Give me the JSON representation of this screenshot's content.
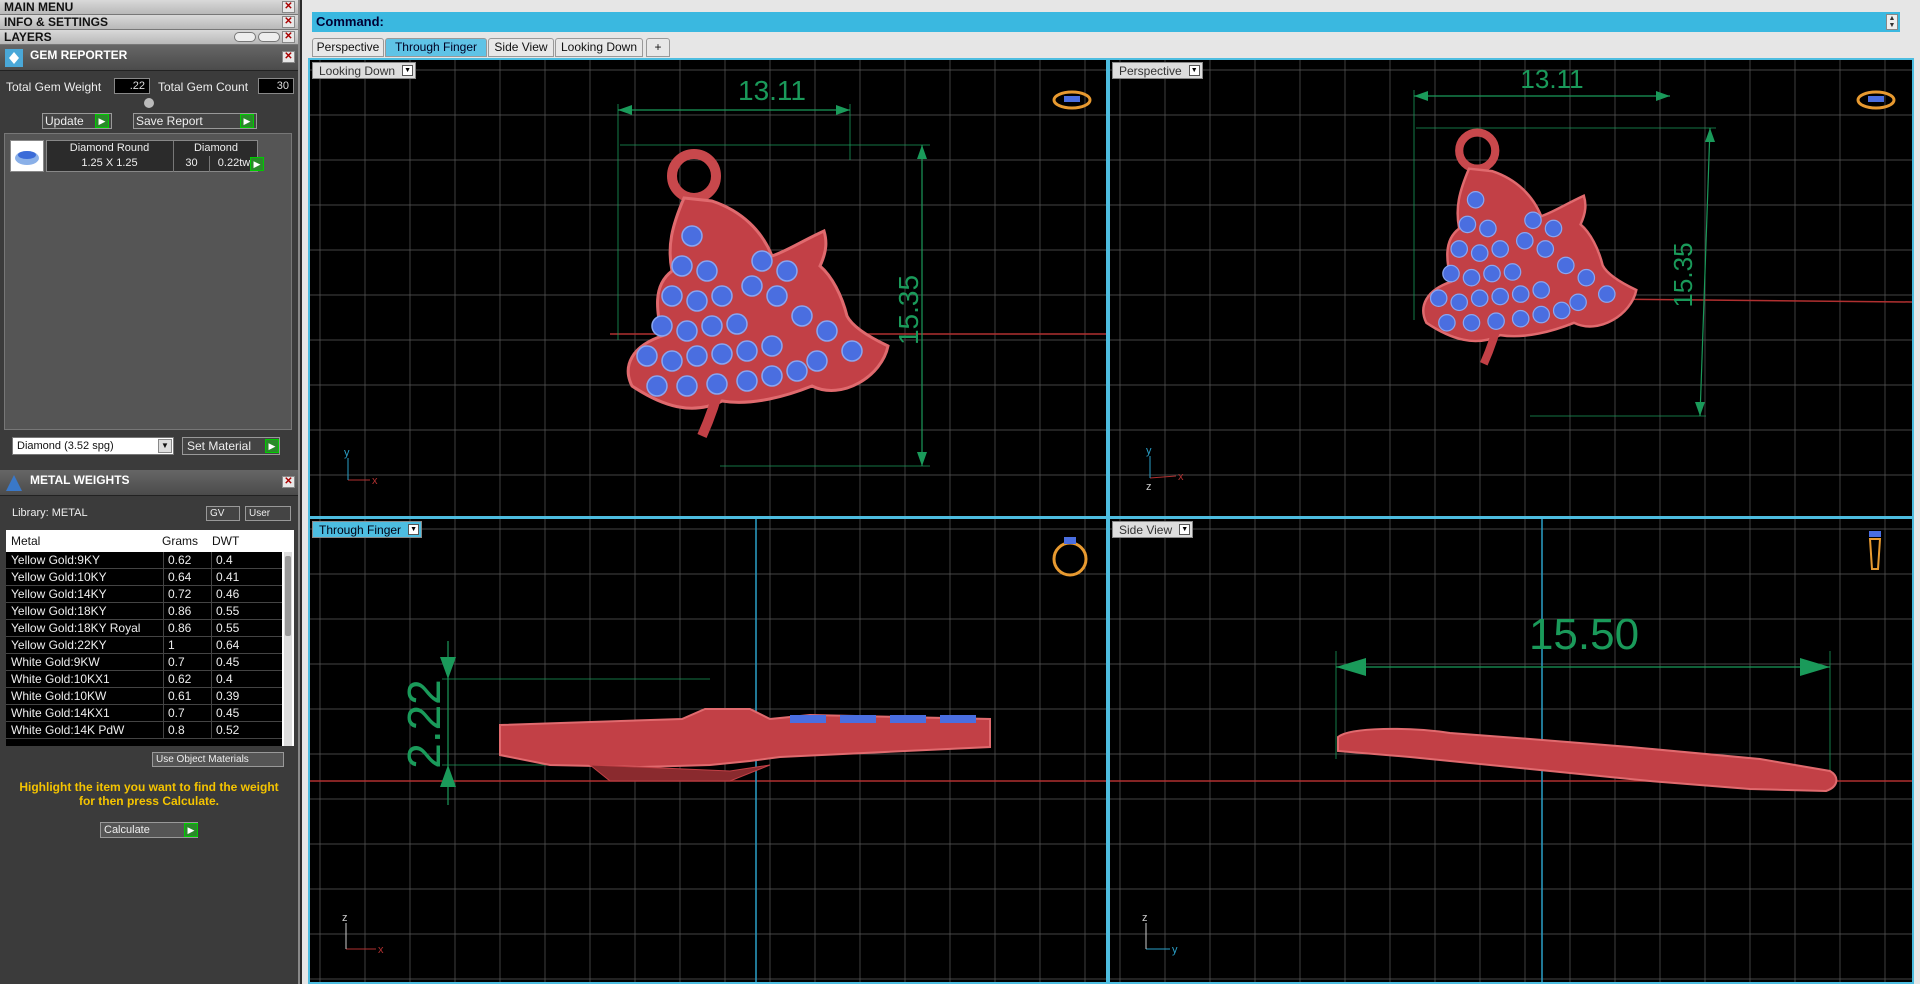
{
  "menu": {
    "main_menu": "MAIN MENU",
    "info_settings": "INFO & SETTINGS",
    "layers": "LAYERS"
  },
  "gem_reporter": {
    "title": "GEM REPORTER",
    "total_weight_label": "Total Gem Weight",
    "total_weight_value": ".22",
    "total_count_label": "Total Gem Count",
    "total_count_value": "30",
    "update_label": "Update",
    "save_report_label": "Save Report",
    "gem": {
      "name": "Diamond Round",
      "type": "Diamond",
      "size": "1.25 X 1.25",
      "count": "30",
      "weight": "0.22tw"
    },
    "material_select": "Diamond    (3.52 spg)",
    "set_material_label": "Set Material"
  },
  "metal_weights": {
    "title": "METAL WEIGHTS",
    "library_label": "Library: METAL",
    "gv_label": "GV",
    "user_label": "User",
    "columns": [
      "Metal",
      "Grams",
      "DWT"
    ],
    "rows": [
      {
        "metal": "Yellow Gold:9KY",
        "grams": "0.62",
        "dwt": "0.4"
      },
      {
        "metal": "Yellow Gold:10KY",
        "grams": "0.64",
        "dwt": "0.41"
      },
      {
        "metal": "Yellow Gold:14KY",
        "grams": "0.72",
        "dwt": "0.46"
      },
      {
        "metal": "Yellow Gold:18KY",
        "grams": "0.86",
        "dwt": "0.55"
      },
      {
        "metal": "Yellow Gold:18KY Royal",
        "grams": "0.86",
        "dwt": "0.55"
      },
      {
        "metal": "Yellow Gold:22KY",
        "grams": "1",
        "dwt": "0.64"
      },
      {
        "metal": "White Gold:9KW",
        "grams": "0.7",
        "dwt": "0.45"
      },
      {
        "metal": "White Gold:10KX1",
        "grams": "0.62",
        "dwt": "0.4"
      },
      {
        "metal": "White Gold:10KW",
        "grams": "0.61",
        "dwt": "0.39"
      },
      {
        "metal": "White Gold:14KX1",
        "grams": "0.7",
        "dwt": "0.45"
      },
      {
        "metal": "White Gold:14K PdW",
        "grams": "0.8",
        "dwt": "0.52"
      }
    ],
    "use_object_materials": "Use Object Materials",
    "hint": "Highlight the item you want to find the weight for then press Calculate.",
    "calculate_label": "Calculate"
  },
  "command_label": "Command:",
  "tabs": [
    "Perspective",
    "Through Finger",
    "Side View",
    "Looking Down",
    "+"
  ],
  "active_tab": 1,
  "viewports": {
    "top_left": {
      "label": "Looking Down",
      "dim_h": "13.11",
      "dim_v": "15.35",
      "axis_x": "x",
      "axis_y": "y"
    },
    "top_right": {
      "label": "Perspective",
      "dim_h": "13.11",
      "dim_v": "15.35",
      "axis_x": "x",
      "axis_y": "y",
      "axis_z": "z"
    },
    "bottom_left": {
      "label": "Through Finger",
      "dim_v": "2.22",
      "axis_x": "x",
      "axis_y": "z"
    },
    "bottom_right": {
      "label": "Side View",
      "dim_h": "15.50",
      "axis_x": "y",
      "axis_y": "z"
    }
  },
  "colors": {
    "accent": "#3ab8e0",
    "model": "#c8484c",
    "gem": "#4a6ee0",
    "dimension": "#1a9a5a",
    "grid": "#5a5a5a"
  }
}
